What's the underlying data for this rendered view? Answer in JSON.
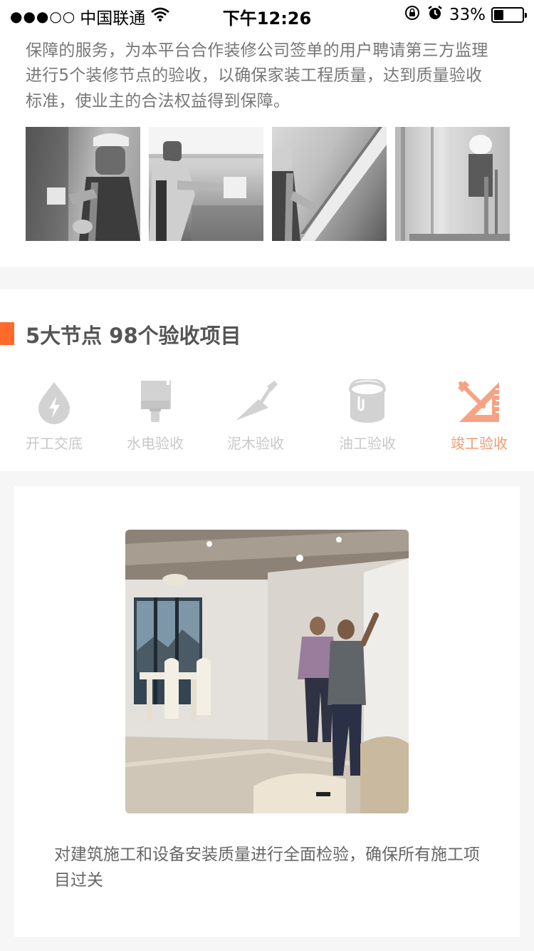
{
  "status_bar": {
    "signal": "●●●○○",
    "carrier": "中国联通",
    "time": "下午12:26",
    "battery_percent": "33%",
    "battery_level": 0.33,
    "icons": [
      "wifi-icon",
      "orientation-lock-icon",
      "alarm-icon",
      "battery-icon"
    ]
  },
  "intro": {
    "line1": "保障的服务，为本平台合作装修公司签单的用户聘请第三方监理",
    "line2": "进行5个装修节点的验收，以确保家装工程质量，达到质量验收",
    "line3": "标准，使业主的合法权益得到保障。",
    "photos": [
      "inspector-checking-switch-photo",
      "inspector-checking-kitchen-photo",
      "inspector-checking-wall-photo",
      "inspector-checking-bathroom-photo"
    ]
  },
  "nodes": {
    "title": "5大节点 98个验收项目",
    "accent_color": "#ff6a2a",
    "items": [
      {
        "label": "开工交底",
        "icon": "water-drop-icon",
        "active": false
      },
      {
        "label": "水电验收",
        "icon": "paint-brush-icon",
        "active": false
      },
      {
        "label": "泥木验收",
        "icon": "trowel-icon",
        "active": false
      },
      {
        "label": "油工验收",
        "icon": "paint-bucket-icon",
        "active": false
      },
      {
        "label": "竣工验收",
        "icon": "ruler-square-icon",
        "active": true
      }
    ]
  },
  "detail": {
    "image": "completion-inspection-room-photo",
    "description": "对建筑施工和设备安装质量进行全面检验，确保所有施工项目过关"
  }
}
